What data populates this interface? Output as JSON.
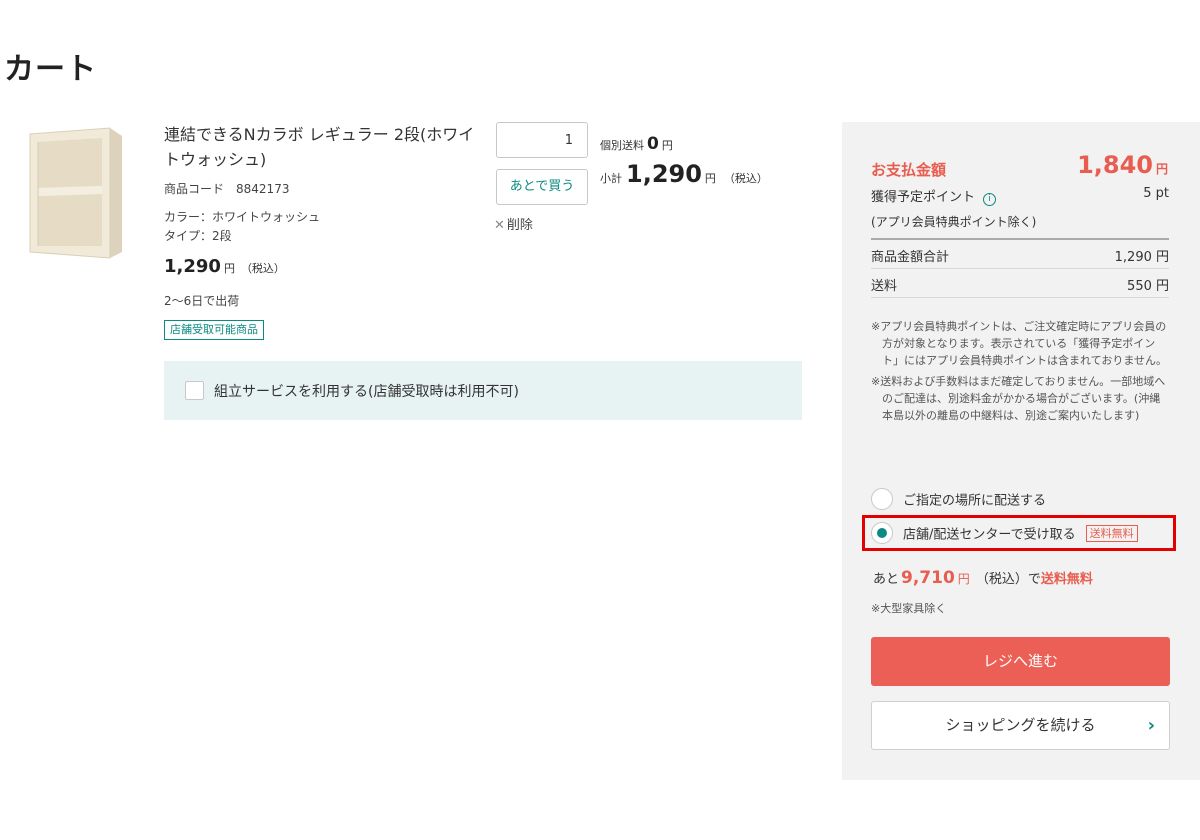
{
  "page": {
    "title": "カート"
  },
  "product": {
    "name": "連結できるNカラボ レギュラー 2段(ホワイトウォッシュ)",
    "code_label": "商品コード",
    "code": "8842173",
    "color": "カラー：ホワイトウォッシュ",
    "type": "タイプ：2段",
    "price": "1,290",
    "price_unit": "円",
    "price_tax": "（税込）",
    "ship_days": "2〜6日で出荷",
    "store_badge": "店舗受取可能商品"
  },
  "quantity": {
    "value": "1"
  },
  "actions": {
    "buy_later": "あとで買う",
    "delete": "削除",
    "delete_icon": "close-icon"
  },
  "individual_shipping": {
    "label": "個別送料",
    "value": "0",
    "unit": "円"
  },
  "subtotal": {
    "label": "小計",
    "value": "1,290",
    "unit": "円",
    "tax": "（税込）"
  },
  "assembly": {
    "label": "組立サービスを利用する(店舗受取時は利用不可)",
    "checked": false
  },
  "summary": {
    "pay_label": "お支払金額",
    "pay_amount": "1,840",
    "pay_unit": "円",
    "points_label": "獲得予定ポイント",
    "points_value": "5 pt",
    "points_note": "(アプリ会員特典ポイント除く)",
    "items_total_label": "商品金額合計",
    "items_total_value": "1,290 円",
    "shipping_label": "送料",
    "shipping_value": "550 円",
    "note1": "※アプリ会員特典ポイントは、ご注文確定時にアプリ会員の方が対象となります。表示されている「獲得予定ポイント」にはアプリ会員特典ポイントは含まれておりません。",
    "note2": "※送料および手数料はまだ確定しておりません。一部地域へのご配達は、別途料金がかかる場合がございます。(沖縄本島以外の離島の中継料は、別途ご案内いたします)"
  },
  "delivery": {
    "option1": "ご指定の場所に配送する",
    "option2": "店舗/配送センターで受け取る",
    "option2_badge": "送料無料",
    "selected": "option2"
  },
  "free_shipping": {
    "prefix": "あと",
    "amount": "9,710",
    "unit": "円",
    "tax_suffix": "（税込）で",
    "free_text": "送料無料",
    "note": "※大型家具除く"
  },
  "buttons": {
    "checkout": "レジへ進む",
    "continue": "ショッピングを続ける",
    "continue_icon": "chevron-right-icon"
  },
  "colors": {
    "accent_teal": "#0a8a82",
    "accent_red": "#e85d4f",
    "checkout_bg": "#eb5f56",
    "highlight": "#e30000"
  }
}
